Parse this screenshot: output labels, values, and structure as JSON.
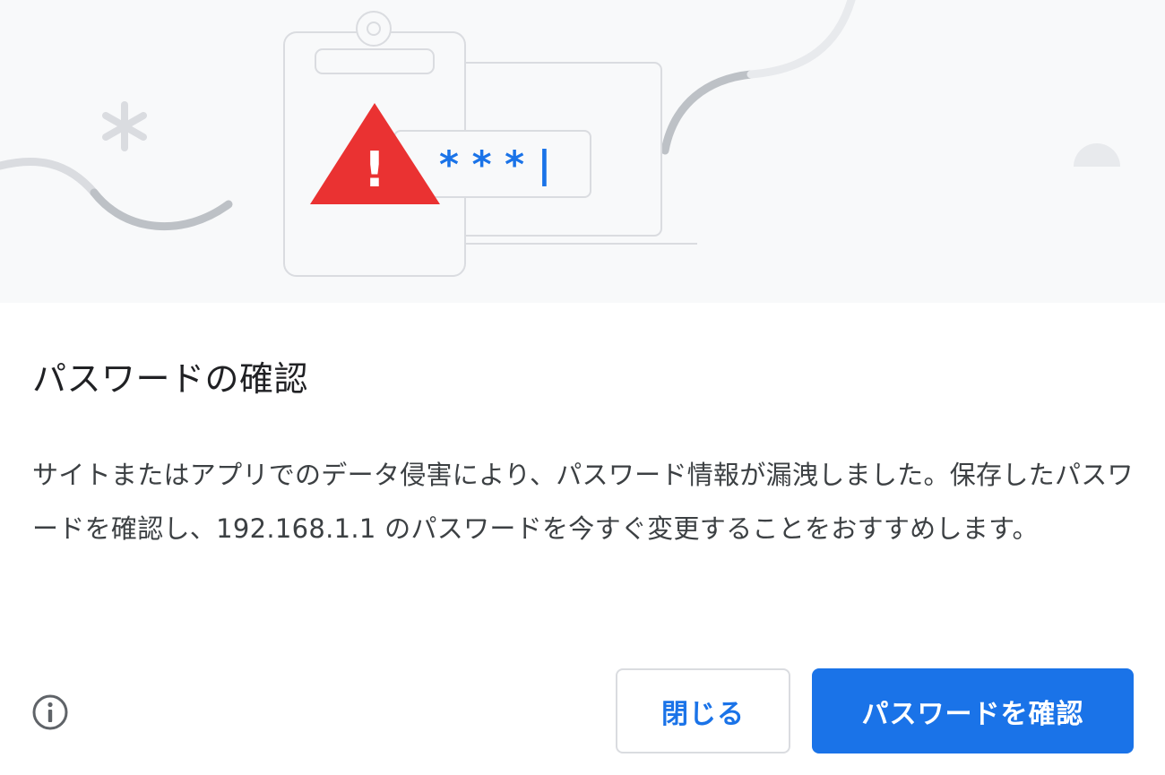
{
  "illustration": {
    "password_mask": "* * * |",
    "warning_symbol": "!"
  },
  "dialog": {
    "title": "パスワードの確認",
    "message": "サイトまたはアプリでのデータ侵害により、パスワード情報が漏洩しました。保存したパスワードを確認し、192.168.1.1 のパスワードを今すぐ変更することをおすすめします。",
    "close_label": "閉じる",
    "check_label": "パスワードを確認"
  },
  "icons": {
    "info": "info-circle-icon",
    "warning": "warning-triangle-icon"
  },
  "colors": {
    "accent": "#1a73e8",
    "warning": "#ea3232",
    "illustration_bg": "#f8f9fa",
    "text_primary": "#202124",
    "text_secondary": "#3c4043"
  }
}
